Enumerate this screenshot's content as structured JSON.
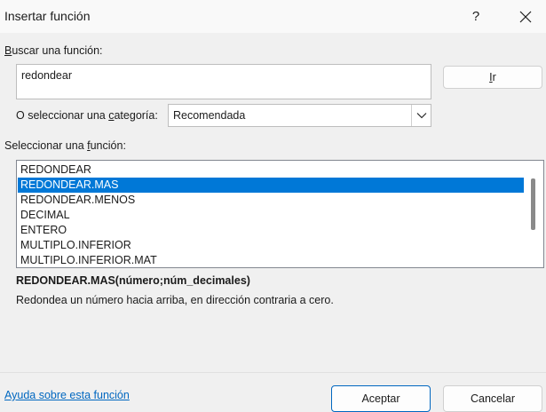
{
  "window": {
    "title": "Insertar función",
    "help_glyph": "?"
  },
  "search": {
    "label_accel": "B",
    "label_rest": "uscar una función:",
    "value": "redondear",
    "go_button_accel": "I",
    "go_button_rest": "r"
  },
  "category": {
    "label_pre": "O seleccionar una ",
    "label_accel": "c",
    "label_post": "ategoría:",
    "selected": "Recomendada"
  },
  "functions": {
    "label_pre": "Seleccionar una ",
    "label_accel": "f",
    "label_post": "unción:",
    "items": [
      {
        "label": "REDONDEAR",
        "selected": false
      },
      {
        "label": "REDONDEAR.MAS",
        "selected": true
      },
      {
        "label": "REDONDEAR.MENOS",
        "selected": false
      },
      {
        "label": "DECIMAL",
        "selected": false
      },
      {
        "label": "ENTERO",
        "selected": false
      },
      {
        "label": "MULTIPLO.INFERIOR",
        "selected": false
      },
      {
        "label": "MULTIPLO.INFERIOR.MAT",
        "selected": false
      }
    ]
  },
  "detail": {
    "signature": "REDONDEAR.MAS(número;núm_decimales)",
    "description": "Redondea un número hacia arriba, en dirección contraria a cero."
  },
  "footer": {
    "help_link": "Ayuda sobre esta función",
    "ok_label": "Aceptar",
    "cancel_label": "Cancelar"
  },
  "colors": {
    "accent": "#0078d7",
    "link": "#0067c0",
    "background": "#f0f0f0"
  }
}
